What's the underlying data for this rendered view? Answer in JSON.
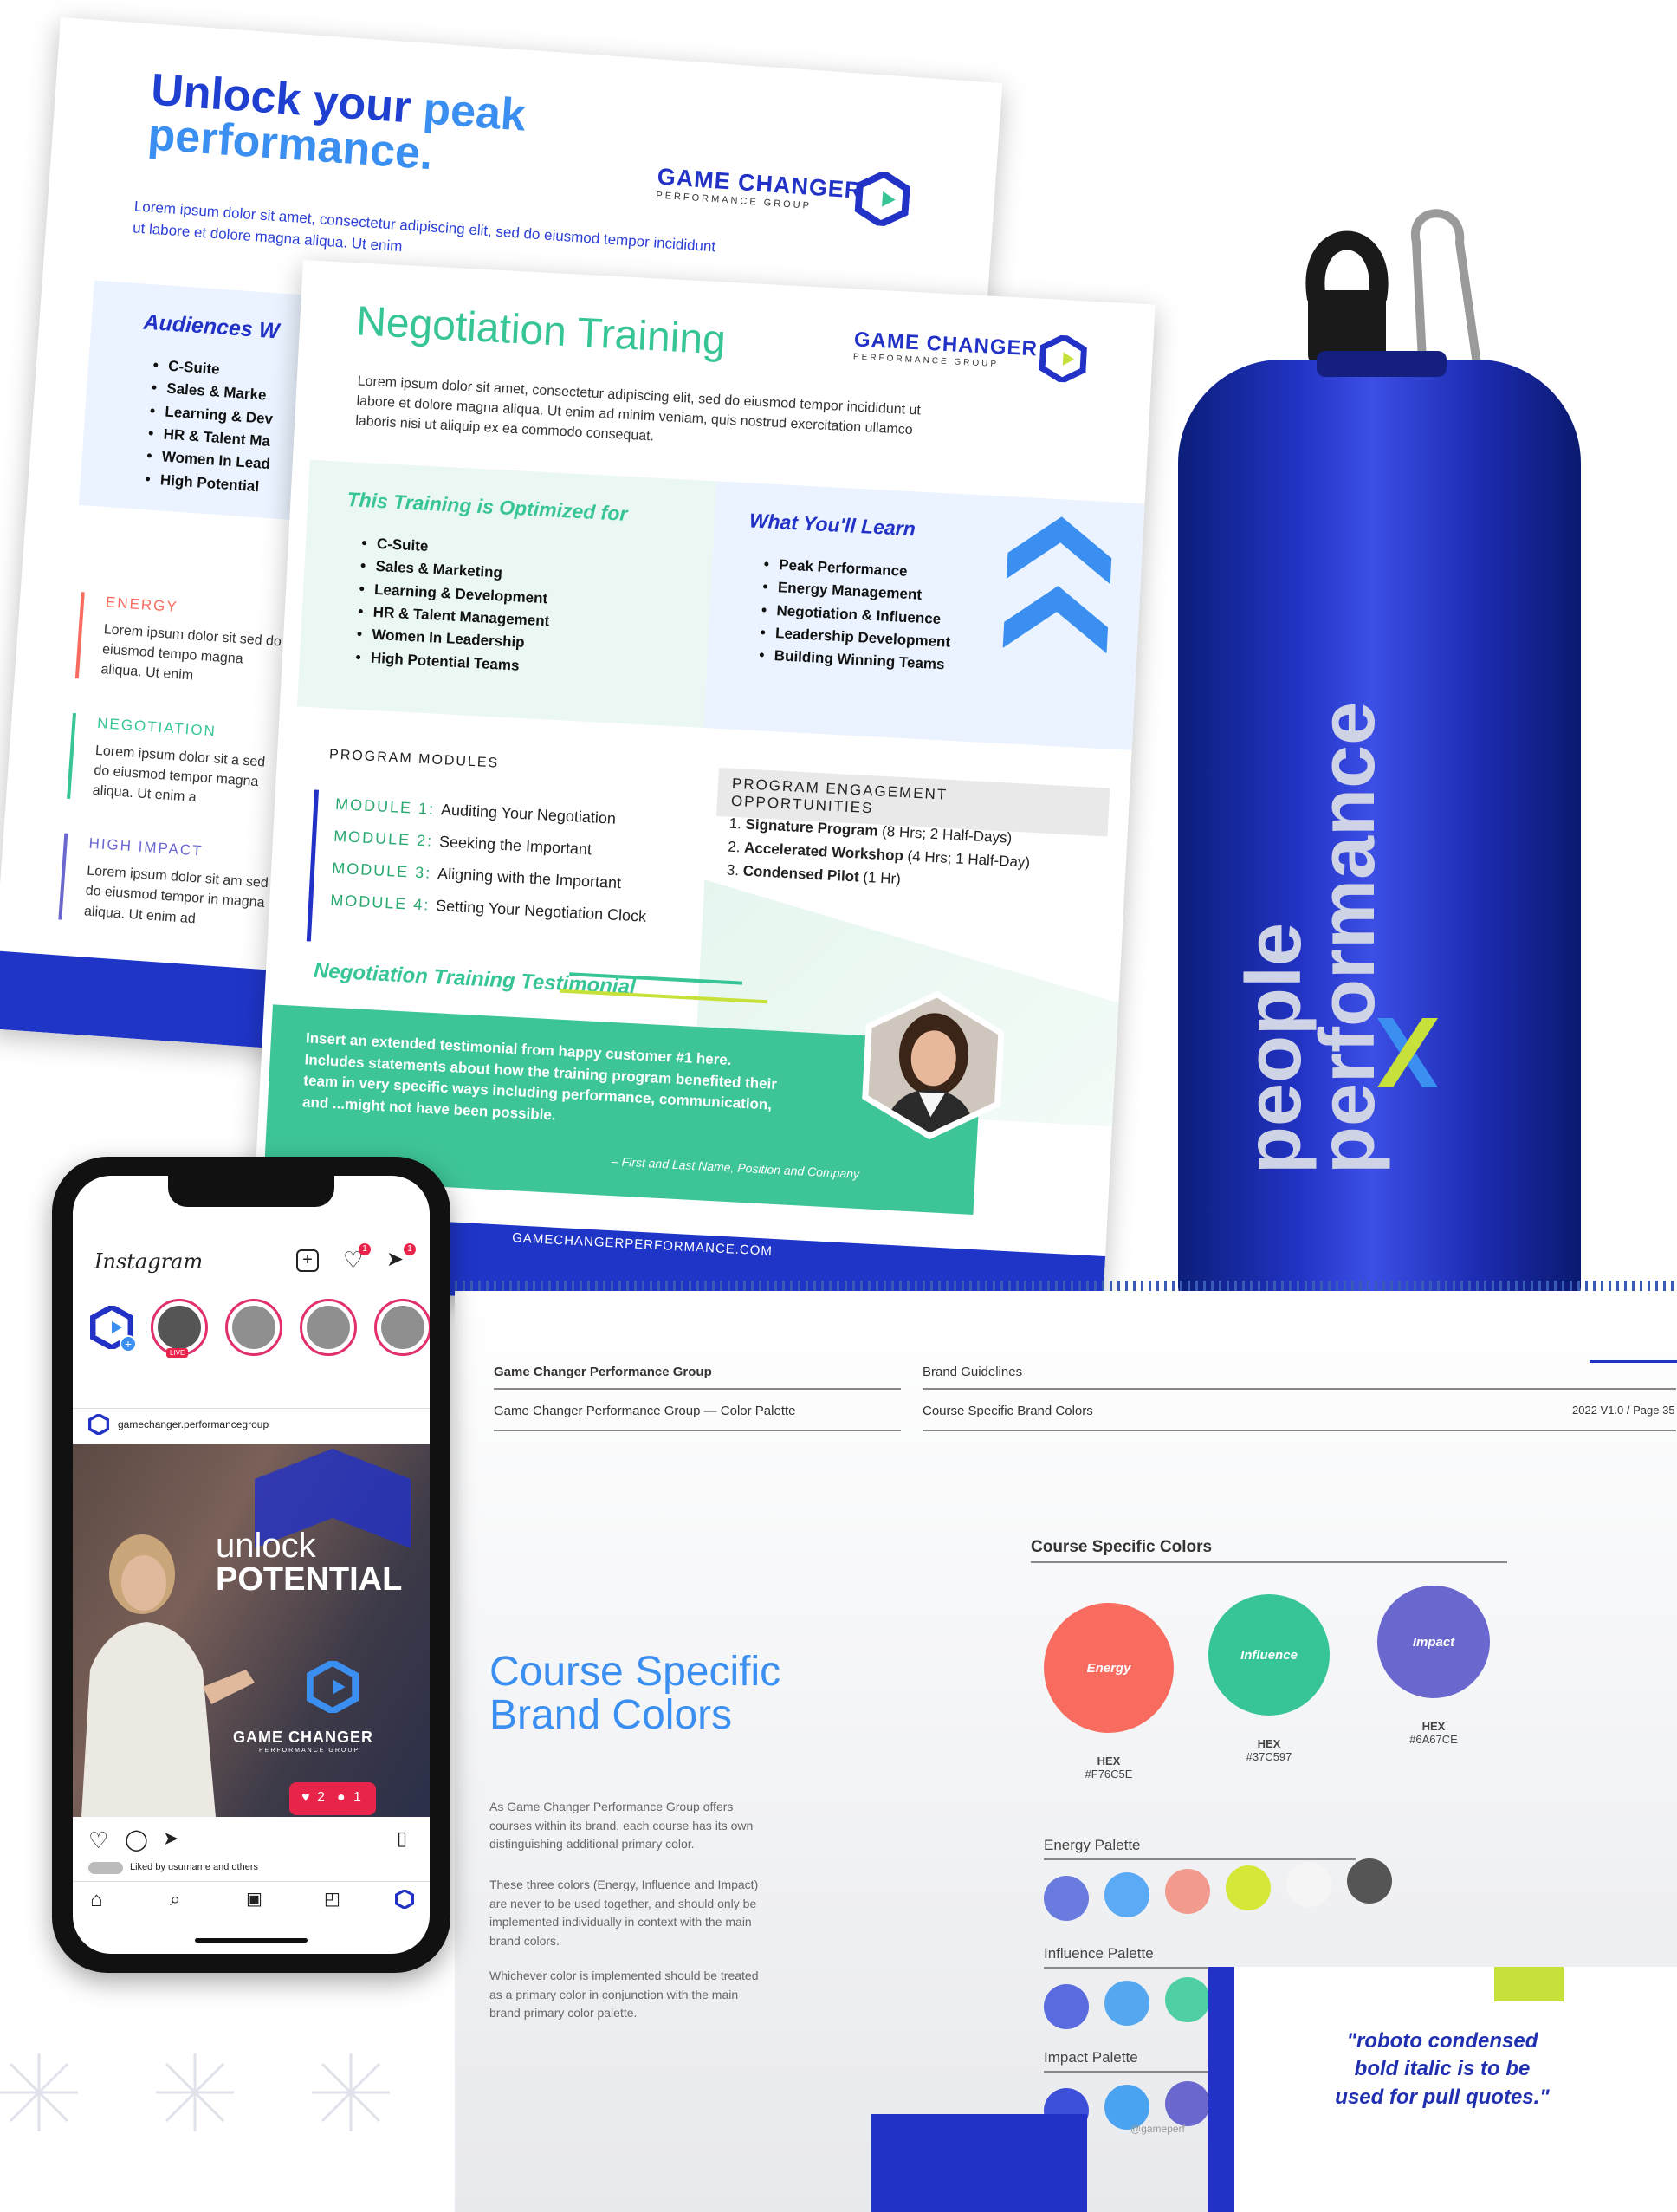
{
  "flyer_peak": {
    "headline_line1": "Unlock your",
    "headline_accent": "peak",
    "headline_line2": "performance.",
    "intro": "Lorem ipsum dolor sit amet, consectetur adipiscing elit, sed do eiusmod tempor incididunt ut labore et dolore magna aliqua. Ut enim",
    "audiences_title": "Audiences W",
    "audiences": [
      "C-Suite",
      "Sales & Marke",
      "Learning & Dev",
      "HR & Talent Ma",
      "Women In Lead",
      "High Potential"
    ],
    "categories": [
      {
        "name": "ENERGY",
        "color": "#F76C5E",
        "text": "Lorem ipsum dolor sit sed do eiusmod tempo magna aliqua. Ut enim"
      },
      {
        "name": "NEGOTIATION",
        "color": "#37C597",
        "text": "Lorem ipsum dolor sit a sed do eiusmod tempor magna aliqua. Ut enim a"
      },
      {
        "name": "HIGH IMPACT",
        "color": "#6A67CE",
        "text": "Lorem ipsum dolor sit am sed do eiusmod tempor in magna aliqua. Ut enim ad"
      }
    ]
  },
  "logo": {
    "title": "GAME CHANGER",
    "subtitle": "PERFORMANCE GROUP"
  },
  "flyer_negotiation": {
    "title": "Negotiation Training",
    "intro": "Lorem ipsum dolor sit amet, consectetur adipiscing elit, sed do eiusmod tempor incididunt ut labore et dolore magna aliqua. Ut enim ad minim veniam, quis nostrud exercitation ullamco laboris nisi ut aliquip ex ea commodo consequat.",
    "optimized_title": "This Training is Optimized for",
    "optimized": [
      "C-Suite",
      "Sales & Marketing",
      "Learning & Development",
      "HR & Talent Management",
      "Women In Leadership",
      "High Potential Teams"
    ],
    "learn_title": "What You'll Learn",
    "learn": [
      "Peak Performance",
      "Energy Management",
      "Negotiation & Influence",
      "Leadership Development",
      "Building Winning Teams"
    ],
    "modules_title": "PROGRAM MODULES",
    "modules": [
      {
        "num": "MODULE 1:",
        "name": "Auditing Your Negotiation"
      },
      {
        "num": "MODULE 2:",
        "name": "Seeking the Important"
      },
      {
        "num": "MODULE 3:",
        "name": "Aligning with the Important"
      },
      {
        "num": "MODULE 4:",
        "name": "Setting Your Negotiation Clock"
      }
    ],
    "engagement_title": "PROGRAM ENGAGEMENT OPPORTUNITIES",
    "engagement": [
      {
        "name": "Signature Program",
        "detail": "(8 Hrs; 2 Half-Days)"
      },
      {
        "name": "Accelerated Workshop",
        "detail": "(4 Hrs; 1 Half-Day)"
      },
      {
        "name": "Condensed Pilot",
        "detail": "(1 Hr)"
      }
    ],
    "testimonial_title": "Negotiation Training Testimonial",
    "testimonial_text": "Insert an extended testimonial from happy customer #1 here. Includes statements about how the training program benefited their team in very specific ways including performance, communication, and ...might not have been possible.",
    "testimonial_author": "– First and Last Name, Position and Company",
    "footer_url": "GAMECHANGERPERFORMANCE.COM"
  },
  "bottle": {
    "word1": "people",
    "word2": "performance",
    "mark": "X",
    "colors": {
      "mark_blue": "#3b8ff0",
      "mark_green": "#c8e03a"
    }
  },
  "phone": {
    "app_name": "Instagram",
    "icons": [
      "add-post-icon",
      "heart-icon",
      "send-icon"
    ],
    "notif_badges": [
      "1",
      "1"
    ],
    "live_badge": "LIVE",
    "account": "gamechanger.performancegroup",
    "post_text1": "unlock",
    "post_text2": "POTENTIAL",
    "post_logo_title": "GAME CHANGER",
    "post_logo_sub": "PERFORMANCE GROUP",
    "likes_text": "Liked by usurname and others",
    "likes_user": "usurname",
    "activity": {
      "likes": "2",
      "comments": "1"
    }
  },
  "guideline": {
    "hdr_left_title": "Game Changer Performance Group",
    "hdr_left_sub": "Game Changer Performance Group — Color Palette",
    "hdr_mid_title": "Brand Guidelines",
    "hdr_mid_sub": "Course Specific Brand Colors",
    "hdr_right": "2022 V1.0 / Page 35",
    "title_line1": "Course Specific",
    "title_line2": "Brand Colors",
    "para1": "As Game Changer Performance Group offers courses within its brand, each course has its own distinguishing additional primary color.",
    "para2": "These three colors (Energy, Influence and Impact) are never to be used together, and should only be implemented individually in context with the main brand colors.",
    "para3": "Whichever color is implemented should be treated as a primary color in conjunction with the main brand primary color palette.",
    "colors_title": "Course Specific Colors",
    "colors": [
      {
        "name": "Energy",
        "hex_label": "HEX",
        "hex": "#F76C5E"
      },
      {
        "name": "Influence",
        "hex_label": "HEX",
        "hex": "#37C597"
      },
      {
        "name": "Impact",
        "hex_label": "HEX",
        "hex": "#6A67CE"
      }
    ],
    "palettes": [
      {
        "name": "Energy Palette",
        "swatches": [
          "#6a7be0",
          "#5aaaf5",
          "#f39a8f",
          "#d5e83a",
          "#f5f5f5",
          "#555555"
        ]
      },
      {
        "name": "Influence Palette",
        "swatches": [
          "#5a6be0",
          "#55a8f0",
          "#50cfa5",
          "#d5e83a",
          "#f3f3f3",
          "#3a3a3a"
        ]
      },
      {
        "name": "Impact Palette",
        "swatches": [
          "#3d4fd8",
          "#4aa3f0",
          "#6a67ce",
          "#d5e83a",
          "#f3f3f3",
          "#3a3a3a"
        ]
      }
    ],
    "pullquote": "\"roboto condensed bold italic is to be used for pull quotes.\"",
    "footer_snip": "@gameperf"
  }
}
